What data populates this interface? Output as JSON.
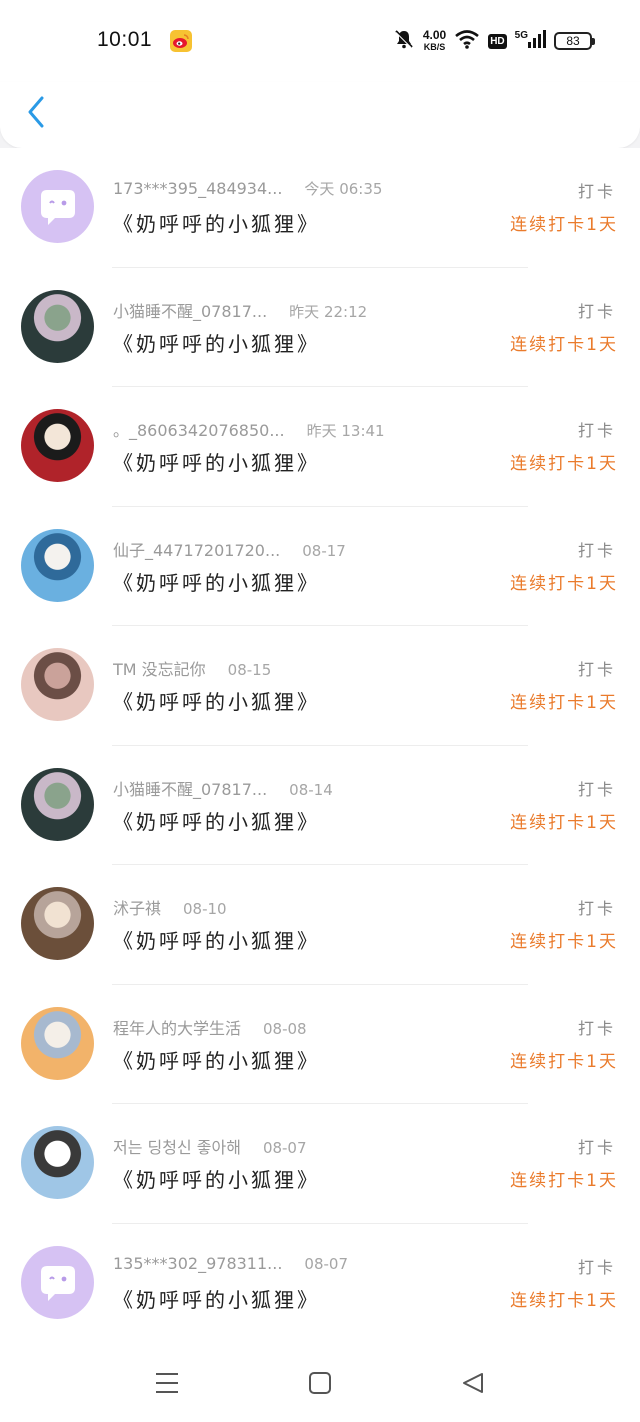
{
  "status_bar": {
    "time": "10:01",
    "net_speed": "4.00",
    "net_speed_unit": "KB/S",
    "hd_badge": "HD",
    "network_type": "5G",
    "battery_level": "83",
    "icons": [
      "weibo-icon",
      "mute-icon",
      "wifi-icon",
      "signal-icon",
      "battery-icon"
    ]
  },
  "header": {
    "back_icon": "chevron-left-icon",
    "accent_color": "#2a9ae6"
  },
  "colors": {
    "streak": "#ea7b2c",
    "name": "#9a9a9a",
    "avatar_default": "#d6c2f3"
  },
  "checkins": [
    {
      "name": "173***395_484934...",
      "time": "今天 06:35",
      "book": "《奶呼呼的小狐狸》",
      "action": "打卡",
      "streak": "连续打卡1天",
      "avatar": "default-chat-avatar"
    },
    {
      "name": "小猫睡不醒_07817...",
      "time": "昨天 22:12",
      "book": "《奶呼呼的小狐狸》",
      "action": "打卡",
      "streak": "连续打卡1天",
      "avatar": "photo-avatar"
    },
    {
      "name": "。_8606342076850...",
      "time": "昨天 13:41",
      "book": "《奶呼呼的小狐狸》",
      "action": "打卡",
      "streak": "连续打卡1天",
      "avatar": "photo-avatar"
    },
    {
      "name": "仙子_44717201720...",
      "time": "08-17",
      "book": "《奶呼呼的小狐狸》",
      "action": "打卡",
      "streak": "连续打卡1天",
      "avatar": "photo-avatar"
    },
    {
      "name": "TM 没忘記你",
      "time": "08-15",
      "book": "《奶呼呼的小狐狸》",
      "action": "打卡",
      "streak": "连续打卡1天",
      "avatar": "photo-avatar"
    },
    {
      "name": "小猫睡不醒_07817...",
      "time": "08-14",
      "book": "《奶呼呼的小狐狸》",
      "action": "打卡",
      "streak": "连续打卡1天",
      "avatar": "photo-avatar"
    },
    {
      "name": "沭子祺",
      "time": "08-10",
      "book": "《奶呼呼的小狐狸》",
      "action": "打卡",
      "streak": "连续打卡1天",
      "avatar": "photo-avatar"
    },
    {
      "name": "程年人的大学生活",
      "time": "08-08",
      "book": "《奶呼呼的小狐狸》",
      "action": "打卡",
      "streak": "连续打卡1天",
      "avatar": "photo-avatar"
    },
    {
      "name": "저는 딩청신 좋아해",
      "time": "08-07",
      "book": "《奶呼呼的小狐狸》",
      "action": "打卡",
      "streak": "连续打卡1天",
      "avatar": "photo-avatar"
    },
    {
      "name": "135***302_978311...",
      "time": "08-07",
      "book": "《奶呼呼的小狐狸》",
      "action": "打卡",
      "streak": "连续打卡1天",
      "avatar": "default-chat-avatar"
    }
  ],
  "system_nav": {
    "icons": [
      "menu-icon",
      "home-square-icon",
      "back-triangle-icon"
    ]
  }
}
